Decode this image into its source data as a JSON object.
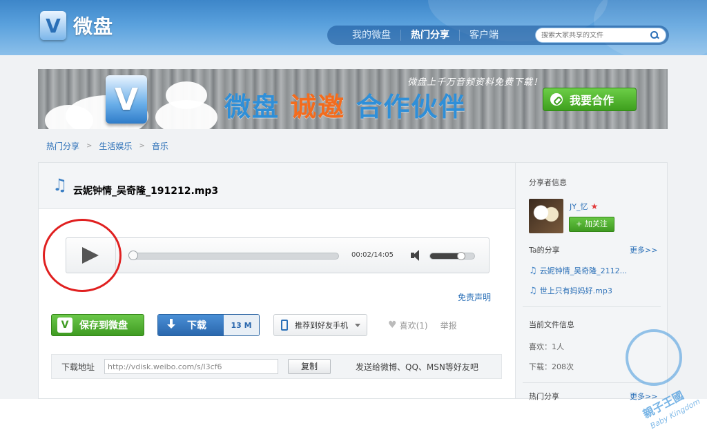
{
  "header": {
    "logo_letter": "V",
    "logo_text": "微盘",
    "nav": [
      "我的微盘",
      "热门分享",
      "客户端"
    ],
    "active_nav": "热门分享",
    "search": {
      "placeholder": "搜索大家共享的文件"
    }
  },
  "banner": {
    "logo_letter": "V",
    "title_part1": "微盘",
    "title_highlight": "诚邀",
    "title_part2": "合作伙伴",
    "slogan": "微盘上千万音频资料免费下载！",
    "button": "我要合作"
  },
  "breadcrumb": [
    "热门分享",
    "生活娱乐",
    "音乐"
  ],
  "file": {
    "name": "云妮钟情_吴奇隆_191212.mp3"
  },
  "player": {
    "time": "00:02/14:05",
    "progress": 0.005,
    "volume": 0.7
  },
  "disclaimer": "免责声明",
  "actions": {
    "save_icon": "V",
    "save": "保存到微盘",
    "download": "下载",
    "size": "13 M",
    "phone": "推荐到好友手机",
    "like_icon": "♥",
    "like": "喜欢(1)",
    "report": "举报"
  },
  "download_bar": {
    "label": "下载地址",
    "url": "http://vdisk.weibo.com/s/I3cf6",
    "copy": "复制",
    "share": "发送给微博、QQ、MSN等好友吧"
  },
  "sidebar": {
    "sharer_title": "分享者信息",
    "username": "JY_忆",
    "star_icon": "★",
    "follow": "+ 加关注",
    "shares_title": "Ta的分享",
    "more": "更多>>",
    "shares": [
      "云妮钟情_吴奇隆_2112...",
      "世上只有妈妈好.mp3"
    ],
    "file_info_title": "当前文件信息",
    "likes": "喜欢：1人",
    "downloads": "下载：208次",
    "hot_title": "热门分享",
    "hot_more": "更多>>"
  },
  "watermark": {
    "text": "親子王國",
    "sub": "Baby Kingdom"
  },
  "colors": {
    "header_blue": "#3d86c9",
    "accent_green": "#3f9b22",
    "link_blue": "#2a6fb7",
    "highlight_orange": "#f36c1e",
    "annotation_red": "#e02020"
  }
}
